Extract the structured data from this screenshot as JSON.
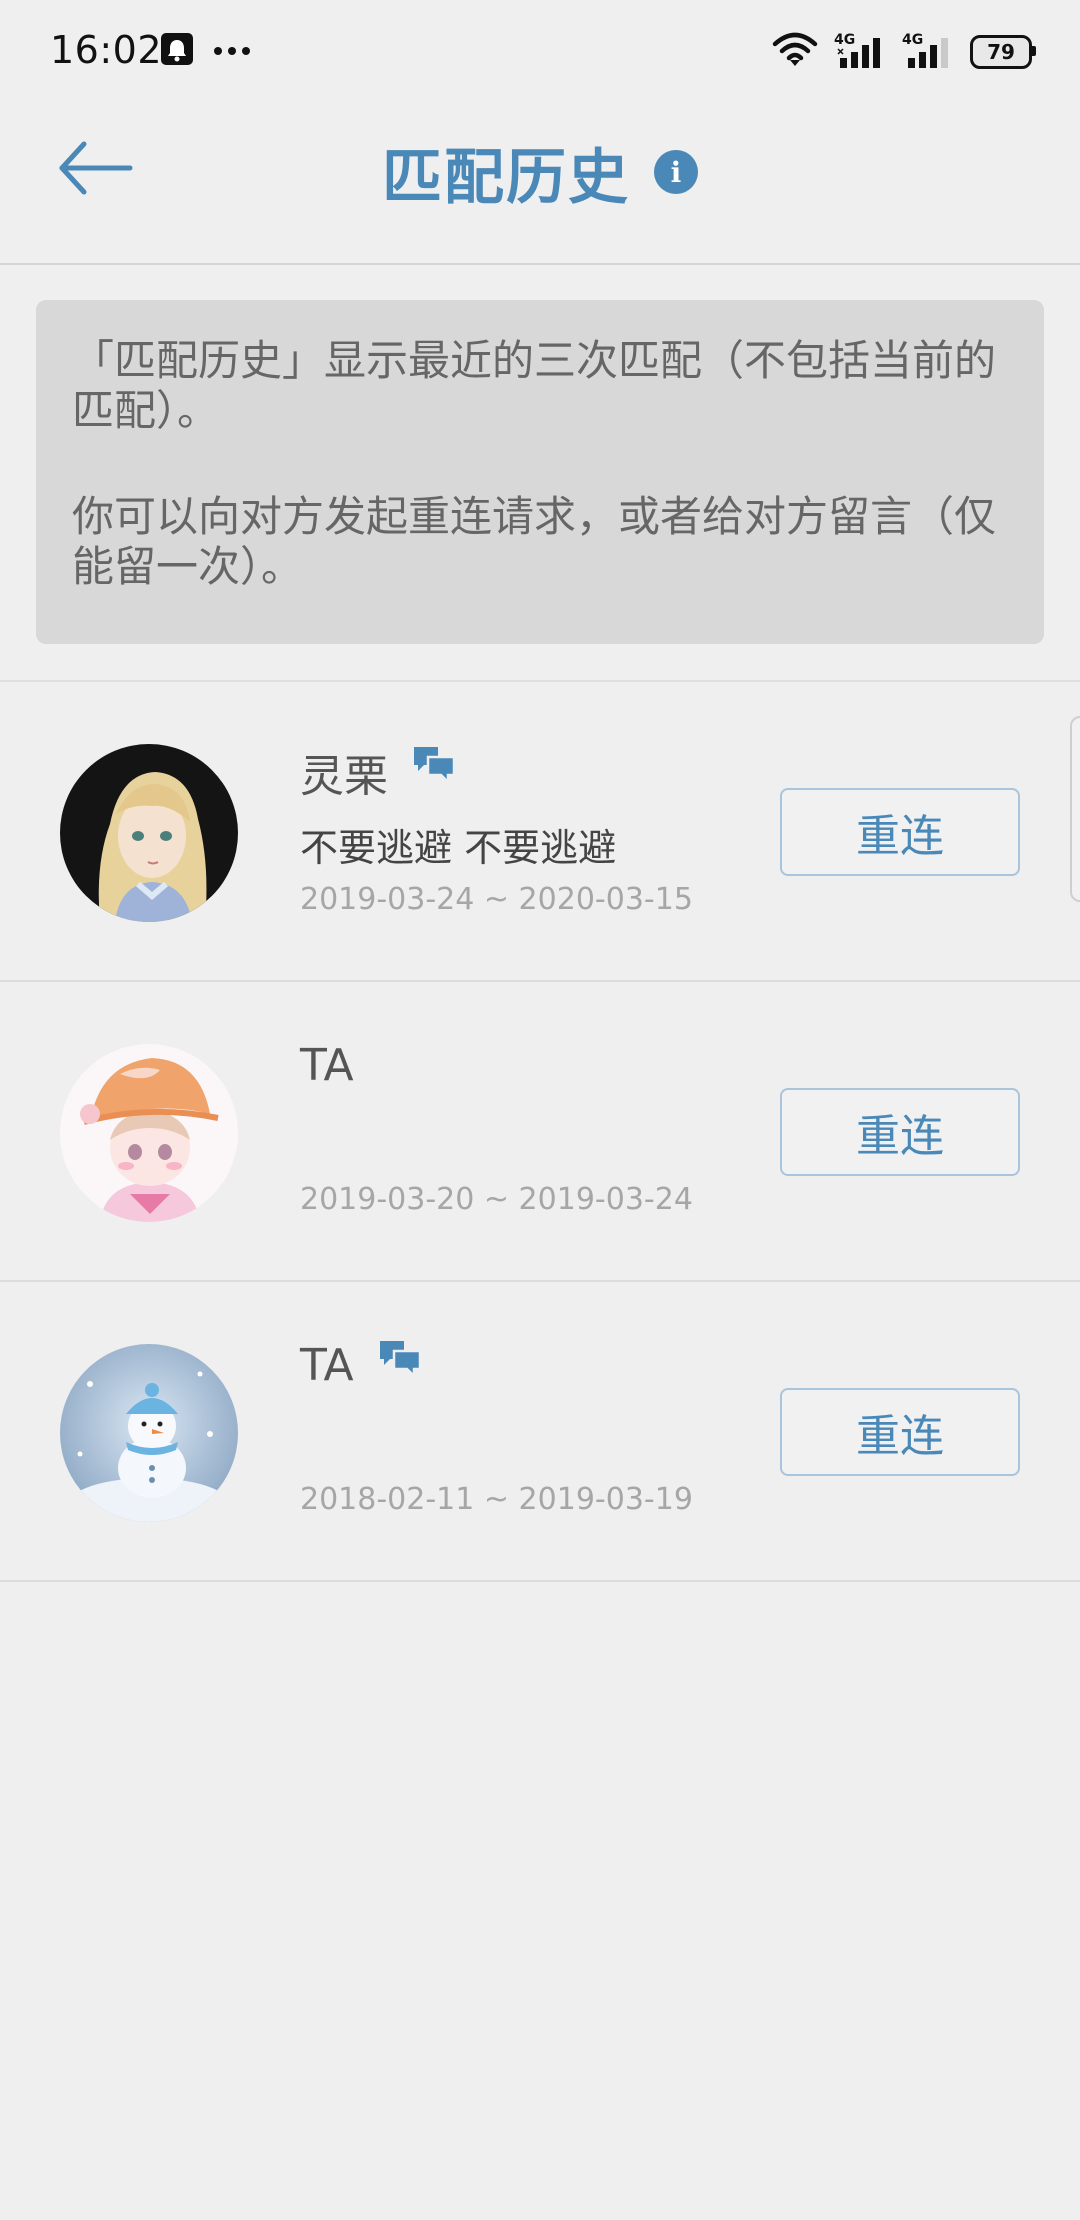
{
  "status_bar": {
    "time": "16:02",
    "battery": "79",
    "network_1": "4G",
    "network_2": "4G",
    "icons": [
      "notification-icon",
      "more-icon",
      "wifi-icon",
      "signal-icon",
      "signal-icon",
      "battery-icon"
    ]
  },
  "header": {
    "title": "匹配历史",
    "back_icon": "arrow-left-icon",
    "info_icon": "info-icon",
    "info_text": "i"
  },
  "notice": {
    "line_1": "「匹配历史」显示最近的三次匹配（不包括当前的匹配）。",
    "line_2": "你可以向对方发起重连请求，或者给对方留言（仅能留一次）。"
  },
  "history": {
    "button_label": "重连",
    "items": [
      {
        "name": "灵栗",
        "message": "不要逃避 不要逃避",
        "dates": "2019-03-24 ~ 2020-03-15",
        "has_chat_icon": true,
        "avatar": "girl-avatar"
      },
      {
        "name": "TA",
        "message": "",
        "dates": "2019-03-20 ~ 2019-03-24",
        "has_chat_icon": false,
        "avatar": "hat-avatar"
      },
      {
        "name": "TA",
        "message": "",
        "dates": "2018-02-11 ~ 2019-03-19",
        "has_chat_icon": true,
        "avatar": "snowman-avatar"
      }
    ]
  },
  "colors": {
    "accent": "#4a88b8",
    "background": "#efefef",
    "notice_background": "#d8d8d8",
    "date_text": "#a6a6a6"
  }
}
